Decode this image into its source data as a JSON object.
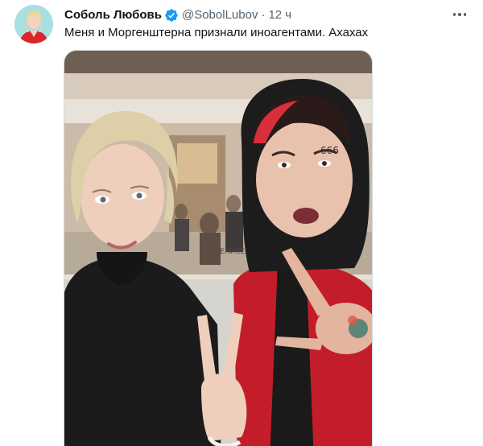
{
  "tweet": {
    "author": {
      "name": "Соболь Любовь",
      "handle": "@SobolLubov",
      "verified": true,
      "avatar_icon": "profile-photo"
    },
    "separator": "·",
    "time": "12 ч",
    "text": "Меня и Моргенштерна признали иноагентами. Ахахах",
    "more_icon": "more-horizontal-icon",
    "media": {
      "type": "photo",
      "description_icon": "selfie-photo",
      "wall_text": "ЕЛИСЕЕВ"
    }
  },
  "colors": {
    "text_primary": "#0f1419",
    "text_secondary": "#536471",
    "verified_blue": "#1d9bf0",
    "border": "#cfd9de"
  }
}
